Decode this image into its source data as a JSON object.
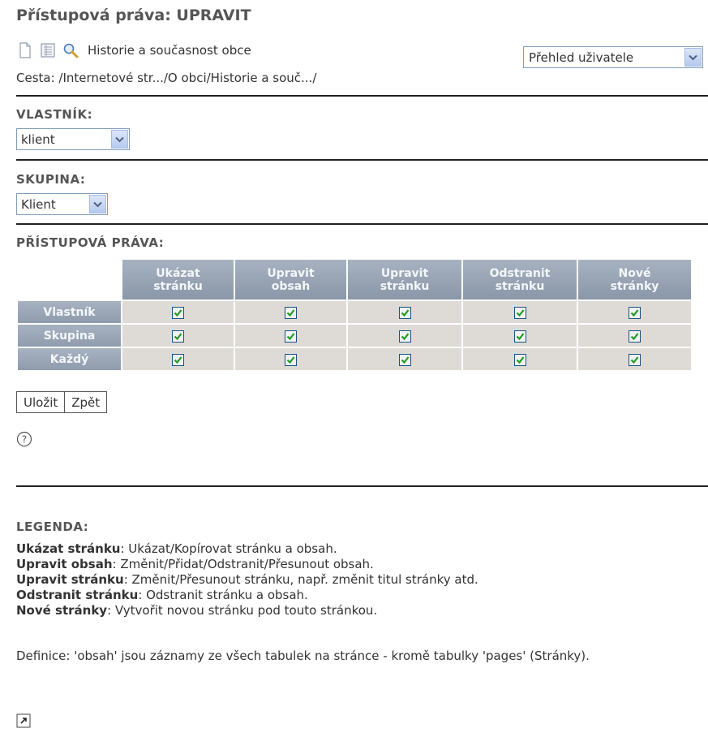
{
  "title": "Přístupová práva: UPRAVIT",
  "toolbar": {
    "icons": [
      "page-icon",
      "list-icon",
      "magnifier-icon"
    ],
    "page_name": "Historie a současnost obce"
  },
  "path": "Cesta: /Internetové str.../O obci/Historie a souč.../",
  "view_select": {
    "value": "Přehled uživatele"
  },
  "owner": {
    "label": "VLASTNÍK:",
    "value": "klient"
  },
  "group": {
    "label": "SKUPINA:",
    "value": "Klient"
  },
  "permissions": {
    "label": "PŘÍSTUPOVÁ PRÁVA:",
    "columns": [
      [
        "Ukázat",
        "stránku"
      ],
      [
        "Upravit",
        "obsah"
      ],
      [
        "Upravit",
        "stránku"
      ],
      [
        "Odstranit",
        "stránku"
      ],
      [
        "Nové",
        "stránky"
      ]
    ],
    "rows": [
      {
        "label": "Vlastník",
        "checked": [
          true,
          true,
          true,
          true,
          true
        ]
      },
      {
        "label": "Skupina",
        "checked": [
          true,
          true,
          true,
          true,
          true
        ]
      },
      {
        "label": "Každý",
        "checked": [
          true,
          true,
          true,
          true,
          true
        ]
      }
    ]
  },
  "buttons": {
    "save": "Uložit",
    "back": "Zpět"
  },
  "legend": {
    "title": "LEGENDA:",
    "items": [
      {
        "term": "Ukázat stránku",
        "desc": ": Ukázat/Kopírovat stránku a obsah."
      },
      {
        "term": "Upravit obsah",
        "desc": ": Změnit/Přidat/Odstranit/Přesunout obsah."
      },
      {
        "term": "Upravit stránku",
        "desc": ": Změnit/Přesunout stránku, např. změnit titul stránky atd."
      },
      {
        "term": "Odstranit stránku",
        "desc": ": Odstranit stránku a obsah."
      },
      {
        "term": "Nové stránky",
        "desc": ": Vytvořit novou stránku pod touto stránkou."
      }
    ],
    "definition": "Definice: 'obsah' jsou záznamy ze všech tabulek na stránce - kromě tabulky 'pages' (Stránky)."
  },
  "colors": {
    "header_bg": "#95a1b2",
    "cell_bg": "#dedbd6",
    "check": "#1f9b1f",
    "rule": "#222222"
  }
}
